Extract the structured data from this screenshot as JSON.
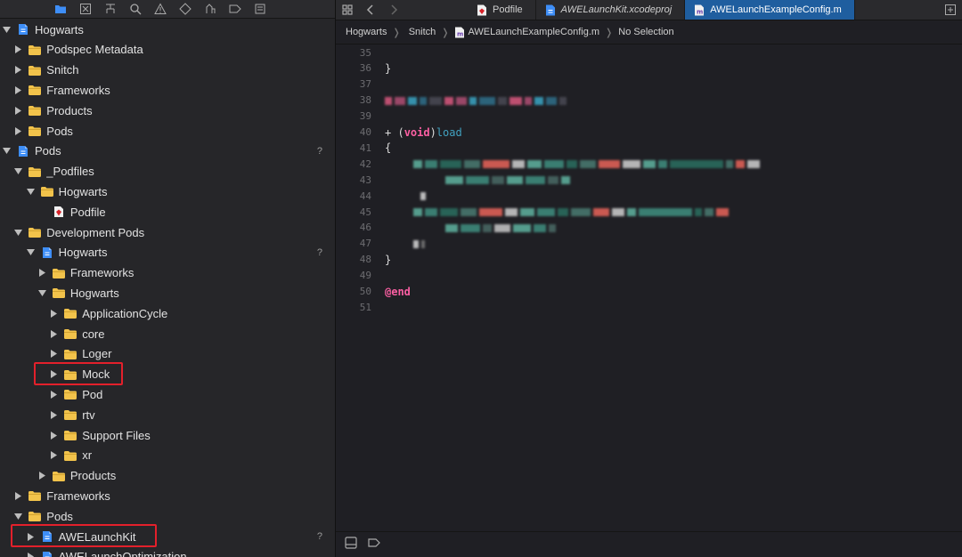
{
  "navigator": {
    "toolbar_icons": [
      "folder-icon",
      "source-control-icon",
      "hierarchy-icon",
      "find-icon",
      "issue-icon",
      "test-icon",
      "debug-icon",
      "breakpoint-icon",
      "report-icon"
    ],
    "rows": [
      {
        "label": "Hogwarts",
        "level": 0,
        "icon": "project",
        "expanded": true,
        "badge": ""
      },
      {
        "label": "Podspec Metadata",
        "level": 1,
        "icon": "folder",
        "expanded": false,
        "badge": ""
      },
      {
        "label": "Snitch",
        "level": 1,
        "icon": "folder",
        "expanded": false,
        "badge": ""
      },
      {
        "label": "Frameworks",
        "level": 1,
        "icon": "folder",
        "expanded": false,
        "badge": ""
      },
      {
        "label": "Products",
        "level": 1,
        "icon": "folder",
        "expanded": false,
        "badge": ""
      },
      {
        "label": "Pods",
        "level": 1,
        "icon": "folder",
        "expanded": false,
        "badge": ""
      },
      {
        "label": "Pods",
        "level": 0,
        "icon": "project",
        "expanded": true,
        "badge": "?"
      },
      {
        "label": "_Podfiles",
        "level": 1,
        "icon": "folder",
        "expanded": true,
        "badge": ""
      },
      {
        "label": "Hogwarts",
        "level": 2,
        "icon": "folder",
        "expanded": true,
        "badge": ""
      },
      {
        "label": "Podfile",
        "level": 3,
        "icon": "ruby",
        "expanded": null,
        "badge": ""
      },
      {
        "label": "Development Pods",
        "level": 1,
        "icon": "folder",
        "expanded": true,
        "badge": ""
      },
      {
        "label": "Hogwarts",
        "level": 2,
        "icon": "project",
        "expanded": true,
        "badge": "?"
      },
      {
        "label": "Frameworks",
        "level": 3,
        "icon": "folder",
        "expanded": false,
        "badge": ""
      },
      {
        "label": "Hogwarts",
        "level": 3,
        "icon": "folder",
        "expanded": true,
        "badge": ""
      },
      {
        "label": "ApplicationCycle",
        "level": 4,
        "icon": "folder",
        "expanded": false,
        "badge": ""
      },
      {
        "label": "core",
        "level": 4,
        "icon": "folder",
        "expanded": false,
        "badge": ""
      },
      {
        "label": "Loger",
        "level": 4,
        "icon": "folder",
        "expanded": false,
        "badge": ""
      },
      {
        "label": "Mock",
        "level": 4,
        "icon": "folder",
        "expanded": false,
        "badge": ""
      },
      {
        "label": "Pod",
        "level": 4,
        "icon": "folder",
        "expanded": false,
        "badge": ""
      },
      {
        "label": "rtv",
        "level": 4,
        "icon": "folder",
        "expanded": false,
        "badge": ""
      },
      {
        "label": "Support Files",
        "level": 4,
        "icon": "folder",
        "expanded": false,
        "badge": ""
      },
      {
        "label": "xr",
        "level": 4,
        "icon": "folder",
        "expanded": false,
        "badge": ""
      },
      {
        "label": "Products",
        "level": 3,
        "icon": "folder",
        "expanded": false,
        "badge": ""
      },
      {
        "label": "Frameworks",
        "level": 1,
        "icon": "folder",
        "expanded": false,
        "badge": ""
      },
      {
        "label": "Pods",
        "level": 1,
        "icon": "folder",
        "expanded": true,
        "badge": ""
      },
      {
        "label": "AWELaunchKit",
        "level": 2,
        "icon": "project",
        "expanded": false,
        "badge": "?"
      },
      {
        "label": "AWELaunchOptimization",
        "level": 2,
        "icon": "project",
        "expanded": false,
        "badge": ""
      }
    ],
    "highlighted": [
      "Mock",
      "AWELaunchKit"
    ]
  },
  "tabs": [
    {
      "label": "Podfile",
      "icon": "ruby",
      "italic": false,
      "active": false
    },
    {
      "label": "AWELaunchKit.xcodeproj",
      "icon": "project",
      "italic": true,
      "active": false
    },
    {
      "label": "AWELaunchExampleConfig.m",
      "icon": "objc",
      "italic": false,
      "active": true
    }
  ],
  "breadcrumb": {
    "items": [
      "Hogwarts",
      "Snitch",
      "AWELaunchExampleConfig.m"
    ],
    "selection": "No Selection"
  },
  "code": {
    "lines": [
      {
        "n": "35",
        "text": ""
      },
      {
        "n": "36",
        "text": "}"
      },
      {
        "n": "37",
        "text": ""
      },
      {
        "n": "38",
        "text": "",
        "redacted": true
      },
      {
        "n": "39",
        "text": ""
      },
      {
        "n": "40",
        "text": "+ (void)load"
      },
      {
        "n": "41",
        "text": "{"
      },
      {
        "n": "42",
        "text": "",
        "redacted": true
      },
      {
        "n": "43",
        "text": "",
        "redacted": true
      },
      {
        "n": "44",
        "text": "",
        "redacted": true
      },
      {
        "n": "45",
        "text": "",
        "redacted": true
      },
      {
        "n": "46",
        "text": "",
        "redacted": true
      },
      {
        "n": "47",
        "text": "",
        "redacted": true
      },
      {
        "n": "48",
        "text": "}"
      },
      {
        "n": "49",
        "text": ""
      },
      {
        "n": "50",
        "text": "@end"
      },
      {
        "n": "51",
        "text": ""
      }
    ],
    "keyword_void": "void",
    "method_name": "load",
    "plus": "+ (",
    "close_paren": ")",
    "end_kw": "@end"
  },
  "colors": {
    "accent_tab": "#1f5e9f",
    "folder": "#f2c34b",
    "keyword": "#fc5fa3",
    "function": "#41a1c0",
    "highlight": "#e3202b"
  }
}
